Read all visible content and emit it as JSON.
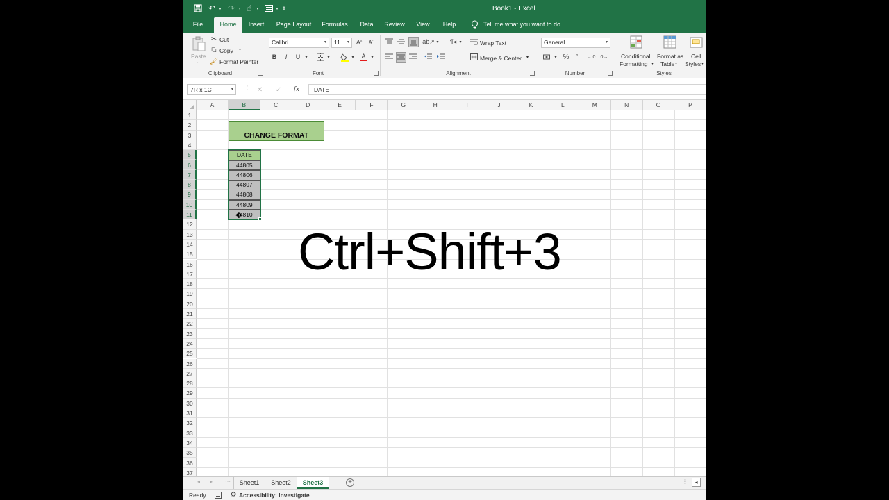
{
  "window": {
    "title": "Book1  -  Excel"
  },
  "quick_access": {
    "save_icon": "save-icon",
    "undo_icon": "undo-icon",
    "redo_icon": "redo-icon",
    "touch_icon": "touch-mode-icon",
    "form_icon": "form-icon",
    "customize_icon": "customize-qat-icon"
  },
  "tabs": [
    "File",
    "Home",
    "Insert",
    "Page Layout",
    "Formulas",
    "Data",
    "Review",
    "View",
    "Help"
  ],
  "tell_me": "Tell me what you want to do",
  "ribbon": {
    "clipboard": {
      "paste": "Paste",
      "cut": "Cut",
      "copy": "Copy",
      "format_painter": "Format Painter",
      "label": "Clipboard"
    },
    "font": {
      "name": "Calibri",
      "size": "11",
      "bold": "B",
      "italic": "I",
      "underline": "U",
      "label": "Font"
    },
    "alignment": {
      "wrap_text": "Wrap Text",
      "merge_center": "Merge & Center",
      "label": "Alignment"
    },
    "number": {
      "format": "General",
      "percent": "%",
      "comma": "’",
      "label": "Number"
    },
    "styles": {
      "conditional": "Conditional",
      "formatting": "Formatting",
      "format_as": "Format as",
      "table": "Table",
      "cell": "Cell",
      "styles_word": "Styles",
      "label": "Styles"
    }
  },
  "formula_bar": {
    "name_box": "7R x 1C",
    "fx": "fx",
    "cancel": "✕",
    "enter": "✓",
    "content": "DATE"
  },
  "columns": [
    "A",
    "B",
    "C",
    "D",
    "E",
    "F",
    "G",
    "H",
    "I",
    "J",
    "K",
    "L",
    "M",
    "N",
    "O",
    "P"
  ],
  "rows": [
    "1",
    "2",
    "3",
    "4",
    "5",
    "6",
    "7",
    "8",
    "9",
    "10",
    "11",
    "12",
    "13",
    "14",
    "15",
    "16",
    "17",
    "18",
    "19",
    "20",
    "21",
    "22",
    "23",
    "24",
    "25",
    "26",
    "27",
    "28",
    "29",
    "30",
    "31",
    "32",
    "33",
    "34",
    "35",
    "36",
    "37"
  ],
  "cells": {
    "title": "CHANGE FORMAT",
    "header": "DATE",
    "values": [
      "44805",
      "44806",
      "44807",
      "44808",
      "44809",
      "44810"
    ]
  },
  "overlay_text": "Ctrl+Shift+3",
  "sheets": [
    "Sheet1",
    "Sheet2",
    "Sheet3"
  ],
  "active_sheet": "Sheet3",
  "status": {
    "ready": "Ready",
    "accessibility": "Accessibility: Investigate"
  },
  "colors": {
    "accent": "#217346",
    "title_fill": "#a9d08e",
    "value_fill": "#bfbfbf"
  }
}
